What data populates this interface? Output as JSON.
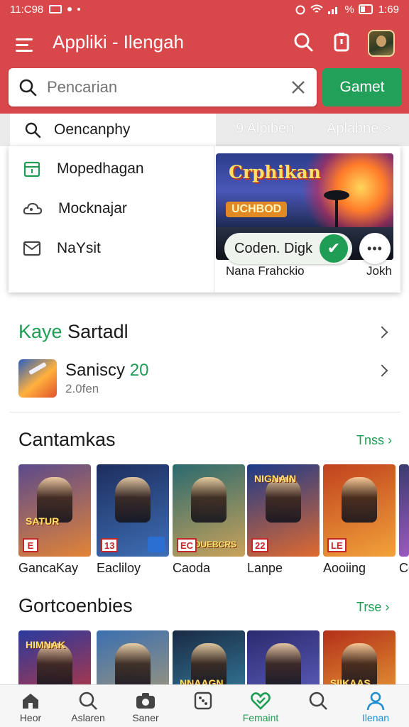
{
  "status": {
    "time": "11:C98",
    "right_time": "1:69",
    "battery": "%"
  },
  "header": {
    "title": "Appliki - Ilengah",
    "search_placeholder": "Pencarian",
    "action_button": "Gamet"
  },
  "suggestion": {
    "text": "Oencanphy",
    "link1": "9 Alpiben",
    "link2": "Aplabne >"
  },
  "dropdown": {
    "items": [
      {
        "label": "Mopedhagan",
        "icon": "calendar-icon"
      },
      {
        "label": "Mocknajar",
        "icon": "cloud-icon"
      },
      {
        "label": "NaYsit",
        "icon": "mail-icon"
      }
    ]
  },
  "feature": {
    "title": "Crphikan",
    "badge": "UCHBOD",
    "pill_label": "Coden. Digk",
    "check": "✔",
    "more": "•••",
    "caption_left": "Nana Frahckio",
    "caption_right": "Jokh"
  },
  "section1": {
    "title_accent": "Kaye",
    "title_rest": "Sartadl",
    "app": {
      "name": "Saniscy",
      "name_num": "20",
      "sub": "2.0fen"
    }
  },
  "section2": {
    "title": "Cantamkas",
    "more": "Tnss",
    "cards": [
      {
        "label": "GancaKay",
        "badge": "E",
        "art": "SATUR",
        "colors": [
          "#5b4a8c",
          "#e28438"
        ]
      },
      {
        "label": "Eacliloy",
        "badge": "13",
        "art": "",
        "colors": [
          "#1d2d5e",
          "#3e6fb5"
        ]
      },
      {
        "label": "Caoda",
        "badge": "EC",
        "art": "OUEBCRS",
        "colors": [
          "#2a6a6e",
          "#c9a25a"
        ]
      },
      {
        "label": "Lanpe",
        "badge": "22",
        "art": "NIGNAIN",
        "colors": [
          "#1c3a8a",
          "#e06a30"
        ]
      },
      {
        "label": "Aooiing",
        "badge": "LE",
        "art": "",
        "colors": [
          "#c0421e",
          "#f2a23a"
        ]
      },
      {
        "label": "Cc",
        "badge": "",
        "art": "",
        "colors": [
          "#3b3b6e",
          "#9a5ac0"
        ]
      }
    ]
  },
  "section3": {
    "title": "Gortcoenbies",
    "more": "Trse",
    "cards": [
      {
        "art": "HIMNAK",
        "colors": [
          "#2a3a9e",
          "#d9372c"
        ]
      },
      {
        "art": "",
        "colors": [
          "#3a6fb0",
          "#b8a070"
        ]
      },
      {
        "art": "NNAAGN",
        "colors": [
          "#1a2a44",
          "#3a8fb0"
        ]
      },
      {
        "art": "",
        "colors": [
          "#2a2a6e",
          "#6a6ad0"
        ]
      },
      {
        "art": "SIIKAAS",
        "colors": [
          "#b3301a",
          "#f2b03a"
        ]
      }
    ]
  },
  "bottom_nav": {
    "items": [
      {
        "label": "Heor",
        "icon": "home-icon"
      },
      {
        "label": "Aslaren",
        "icon": "search-icon"
      },
      {
        "label": "Saner",
        "icon": "camera-icon"
      },
      {
        "label": "",
        "icon": "dice-icon"
      },
      {
        "label": "Femaint",
        "icon": "heart-icon"
      },
      {
        "label": "",
        "icon": "search-icon"
      },
      {
        "label": "Ilenan",
        "icon": "person-icon"
      }
    ]
  },
  "colors": {
    "header": "#d8474a",
    "accent_green": "#1f9d55",
    "accent_blue": "#1f8fd1"
  }
}
